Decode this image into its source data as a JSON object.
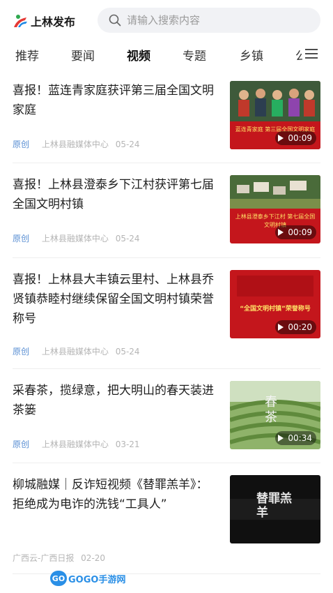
{
  "header": {
    "app_name": "上林发布",
    "search_placeholder": "请输入搜索内容"
  },
  "tabs": [
    {
      "label": "推荐",
      "active": false
    },
    {
      "label": "要闻",
      "active": false
    },
    {
      "label": "视频",
      "active": true
    },
    {
      "label": "专题",
      "active": false
    },
    {
      "label": "乡镇",
      "active": false
    },
    {
      "label": "公",
      "active": false
    }
  ],
  "feed": [
    {
      "title": "喜报！蓝连青家庭获评第三届全国文明家庭",
      "tag": "原创",
      "source": "上林县融媒体中心",
      "date": "05-24",
      "duration": "00:09",
      "thumb_caption": "蓝连青家庭 第三届全国文明家庭"
    },
    {
      "title": "喜报！上林县澄泰乡下江村获评第七届全国文明村镇",
      "tag": "原创",
      "source": "上林县融媒体中心",
      "date": "05-24",
      "duration": "00:09",
      "thumb_caption": "上林县澄泰乡下江村 第七届全国文明村镇"
    },
    {
      "title": "喜报！上林县大丰镇云里村、上林县乔贤镇恭睦村继续保留全国文明村镇荣誉称号",
      "tag": "原创",
      "source": "上林县融媒体中心",
      "date": "05-24",
      "duration": "00:20",
      "thumb_caption": "“全国文明村镇”荣誉称号"
    },
    {
      "title": "采春茶，揽绿意，把大明山的春天装进茶篓",
      "tag": "原创",
      "source": "上林县融媒体中心",
      "date": "03-21",
      "duration": "00:34",
      "thumb_caption": "春茶"
    },
    {
      "title": "柳城融媒｜反诈短视频《替罪羔羊》：拒绝成为电诈的洗钱“工具人”",
      "tag": "",
      "source": "广西云-广西日报",
      "date": "02-20",
      "duration": "",
      "thumb_caption": "替罪羔羊"
    }
  ],
  "watermark": {
    "badge": "GO",
    "text": "GOGO手游网"
  },
  "colors": {
    "accent": "#5a8fd3",
    "meta": "#b5b5b5",
    "banner_red": "#c4161c"
  }
}
